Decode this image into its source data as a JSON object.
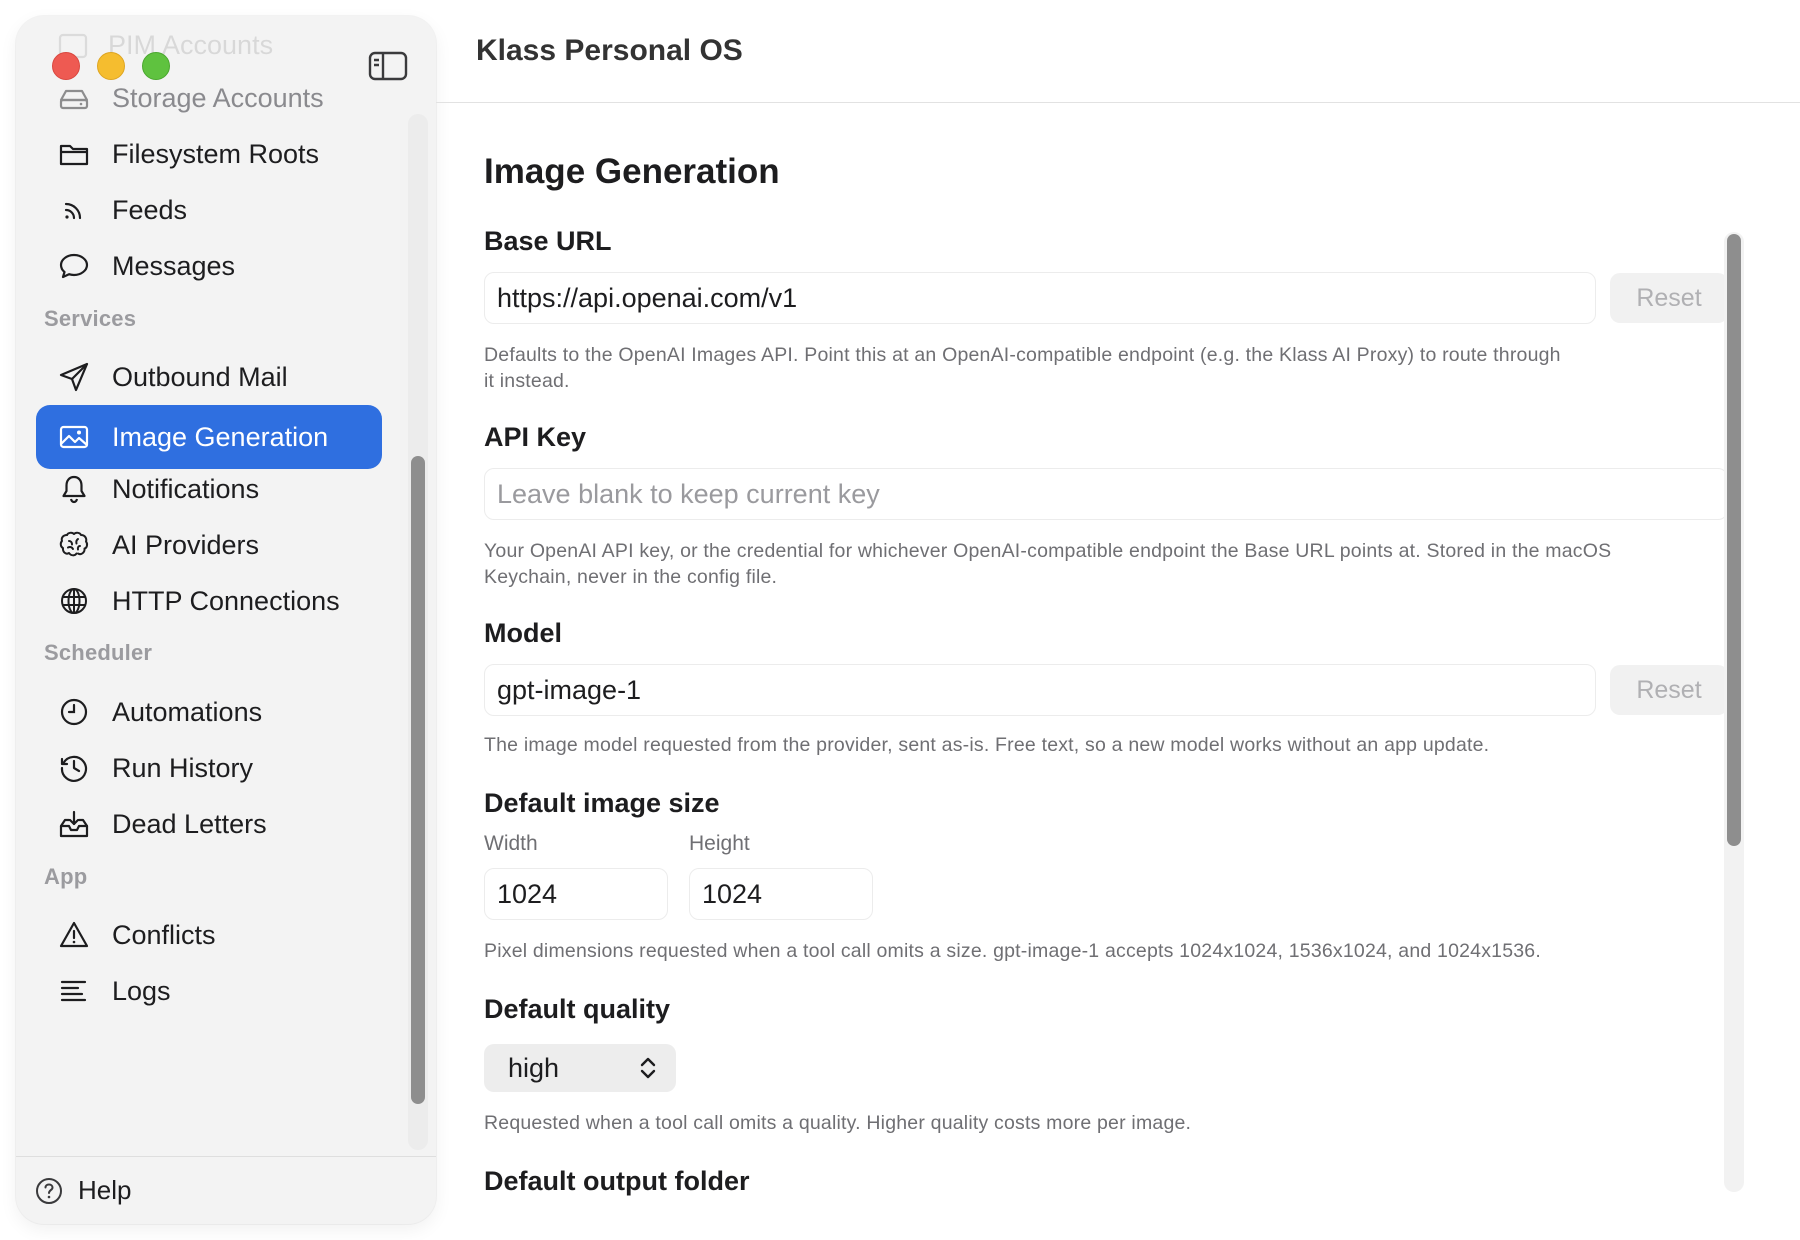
{
  "window": {
    "title": "Klass Personal OS"
  },
  "sidebar": {
    "ghost_label": "PIM Accounts",
    "items": [
      {
        "label": "Storage Accounts",
        "icon": "storage-icon"
      },
      {
        "label": "Filesystem Roots",
        "icon": "folder-icon"
      },
      {
        "label": "Feeds",
        "icon": "rss-icon"
      },
      {
        "label": "Messages",
        "icon": "chat-bubble-icon"
      }
    ],
    "sections": {
      "services": "Services",
      "scheduler": "Scheduler",
      "app": "App"
    },
    "services_items": [
      {
        "label": "Outbound Mail",
        "icon": "paper-plane-icon"
      },
      {
        "label": "Image Generation",
        "icon": "photo-icon",
        "selected": true
      },
      {
        "label": "Notifications",
        "icon": "bell-icon"
      },
      {
        "label": "AI Providers",
        "icon": "brain-icon"
      },
      {
        "label": "HTTP Connections",
        "icon": "globe-icon"
      }
    ],
    "scheduler_items": [
      {
        "label": "Automations",
        "icon": "clock-icon"
      },
      {
        "label": "Run History",
        "icon": "history-icon"
      },
      {
        "label": "Dead Letters",
        "icon": "inbox-tray-icon"
      }
    ],
    "app_items": [
      {
        "label": "Conflicts",
        "icon": "warning-icon"
      },
      {
        "label": "Logs",
        "icon": "list-lines-icon"
      }
    ],
    "help_label": "Help",
    "accent_color": "#2f6fe0"
  },
  "page": {
    "title": "Image Generation",
    "base_url": {
      "label": "Base URL",
      "value": "https://api.openai.com/v1",
      "reset_label": "Reset",
      "help_line1": "Defaults to the OpenAI Images API. Point this at an OpenAI-compatible endpoint (e.g. the Klass AI Proxy) to route through",
      "help_line2": "it instead."
    },
    "api_key": {
      "label": "API Key",
      "placeholder": "Leave blank to keep current key",
      "help_line1": "Your OpenAI API key, or the credential for whichever OpenAI-compatible endpoint the Base URL points at. Stored in the macOS",
      "help_line2": "Keychain, never in the config file."
    },
    "model": {
      "label": "Model",
      "value": "gpt-image-1",
      "reset_label": "Reset",
      "help": "The image model requested from the provider, sent as-is. Free text, so a new model works without an app update."
    },
    "image_size": {
      "label": "Default image size",
      "width_label": "Width",
      "width_value": "1024",
      "height_label": "Height",
      "height_value": "1024",
      "help": "Pixel dimensions requested when a tool call omits a size. gpt-image-1 accepts 1024x1024, 1536x1024, and 1024x1536."
    },
    "quality": {
      "label": "Default quality",
      "value": "high",
      "help": "Requested when a tool call omits a quality. Higher quality costs more per image."
    },
    "output_folder": {
      "label": "Default output folder"
    }
  }
}
